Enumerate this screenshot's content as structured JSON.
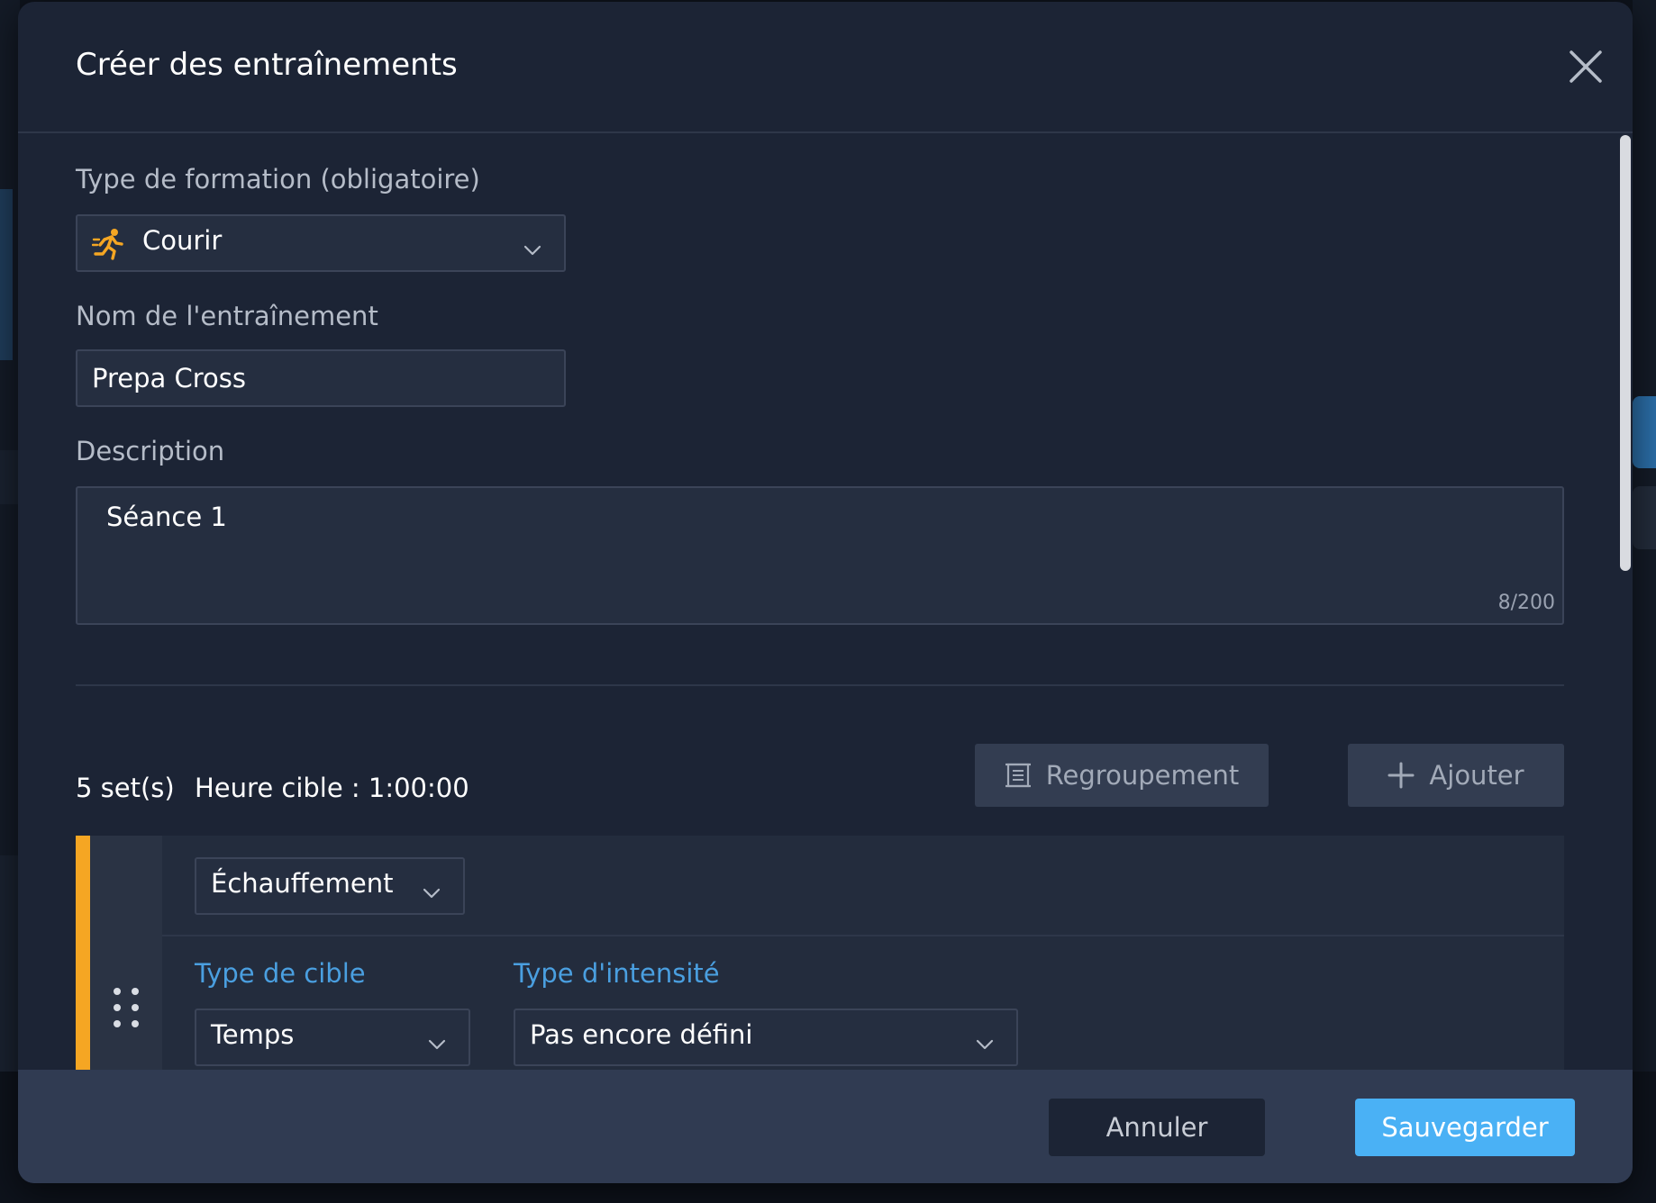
{
  "modal": {
    "title": "Créer des entraînements"
  },
  "training_type": {
    "label": "Type de formation (obligatoire)",
    "value": "Courir",
    "icon": "runner-icon"
  },
  "workout_name": {
    "label": "Nom de l'entraînement",
    "value": "Prepa Cross"
  },
  "description": {
    "label": "Description",
    "value": "Séance 1",
    "counter": "8/200"
  },
  "sets": {
    "count_label": "5 set(s)",
    "target_time_label": "Heure cible : 1:00:00",
    "group_button": "Regroupement",
    "add_button": "Ajouter"
  },
  "set_item": {
    "phase": "Échauffement",
    "target_type_label": "Type de cible",
    "target_type_value": "Temps",
    "intensity_type_label": "Type d'intensité",
    "intensity_type_value": "Pas encore défini"
  },
  "footer": {
    "cancel": "Annuler",
    "save": "Sauvegarder"
  },
  "colors": {
    "accent": "#f5a623",
    "primary": "#4ab1f5",
    "link": "#4a9fe0",
    "modal_bg": "#1c2435"
  }
}
